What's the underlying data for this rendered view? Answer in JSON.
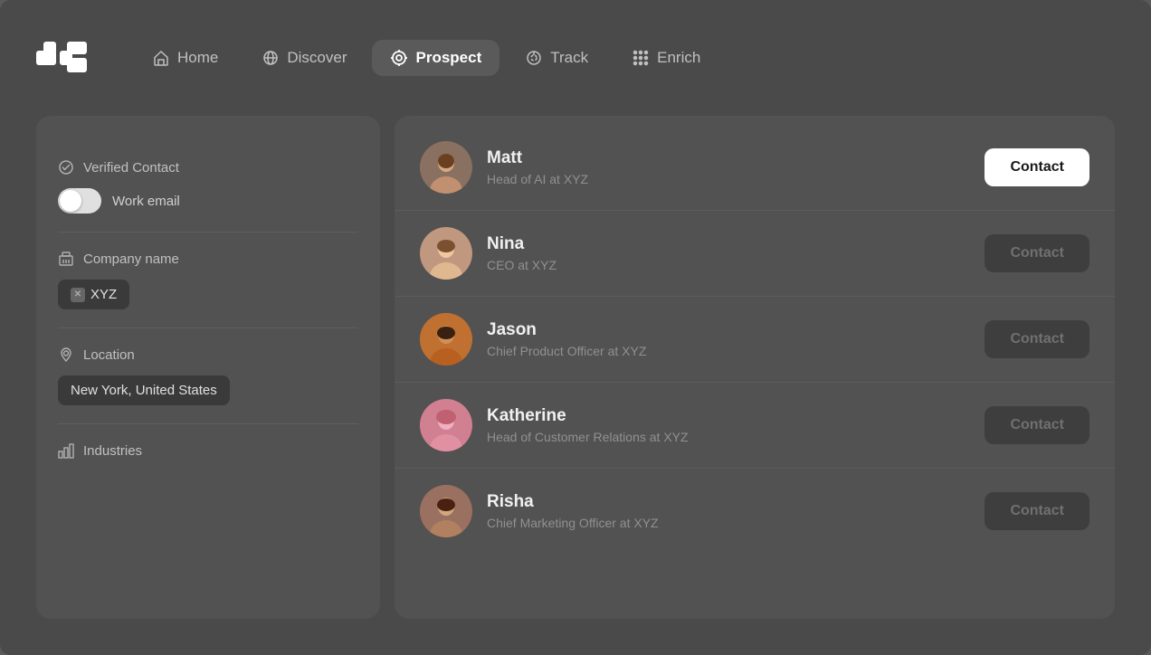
{
  "nav": {
    "logo_alt": "Logo",
    "items": [
      {
        "id": "home",
        "label": "Home",
        "active": false
      },
      {
        "id": "discover",
        "label": "Discover",
        "active": false
      },
      {
        "id": "prospect",
        "label": "Prospect",
        "active": true
      },
      {
        "id": "track",
        "label": "Track",
        "active": false
      },
      {
        "id": "enrich",
        "label": "Enrich",
        "active": false
      }
    ]
  },
  "sidebar": {
    "verified_contact_label": "Verified Contact",
    "work_email_label": "Work email",
    "company_name_label": "Company name",
    "company_value": "XYZ",
    "location_label": "Location",
    "location_value": "New York, United States",
    "industries_label": "Industries"
  },
  "contacts": {
    "items": [
      {
        "id": "matt",
        "name": "Matt",
        "role": "Head of AI at XYZ",
        "btn_label": "Contact",
        "btn_active": true
      },
      {
        "id": "nina",
        "name": "Nina",
        "role": "CEO at XYZ",
        "btn_label": "Contact",
        "btn_active": false
      },
      {
        "id": "jason",
        "name": "Jason",
        "role": "Chief Product Officer at XYZ",
        "btn_label": "Contact",
        "btn_active": false
      },
      {
        "id": "katherine",
        "name": "Katherine",
        "role": "Head of Customer Relations at XYZ",
        "btn_label": "Contact",
        "btn_active": false
      },
      {
        "id": "risha",
        "name": "Risha",
        "role": "Chief Marketing Officer at XYZ",
        "btn_label": "Contact",
        "btn_active": false
      }
    ]
  }
}
